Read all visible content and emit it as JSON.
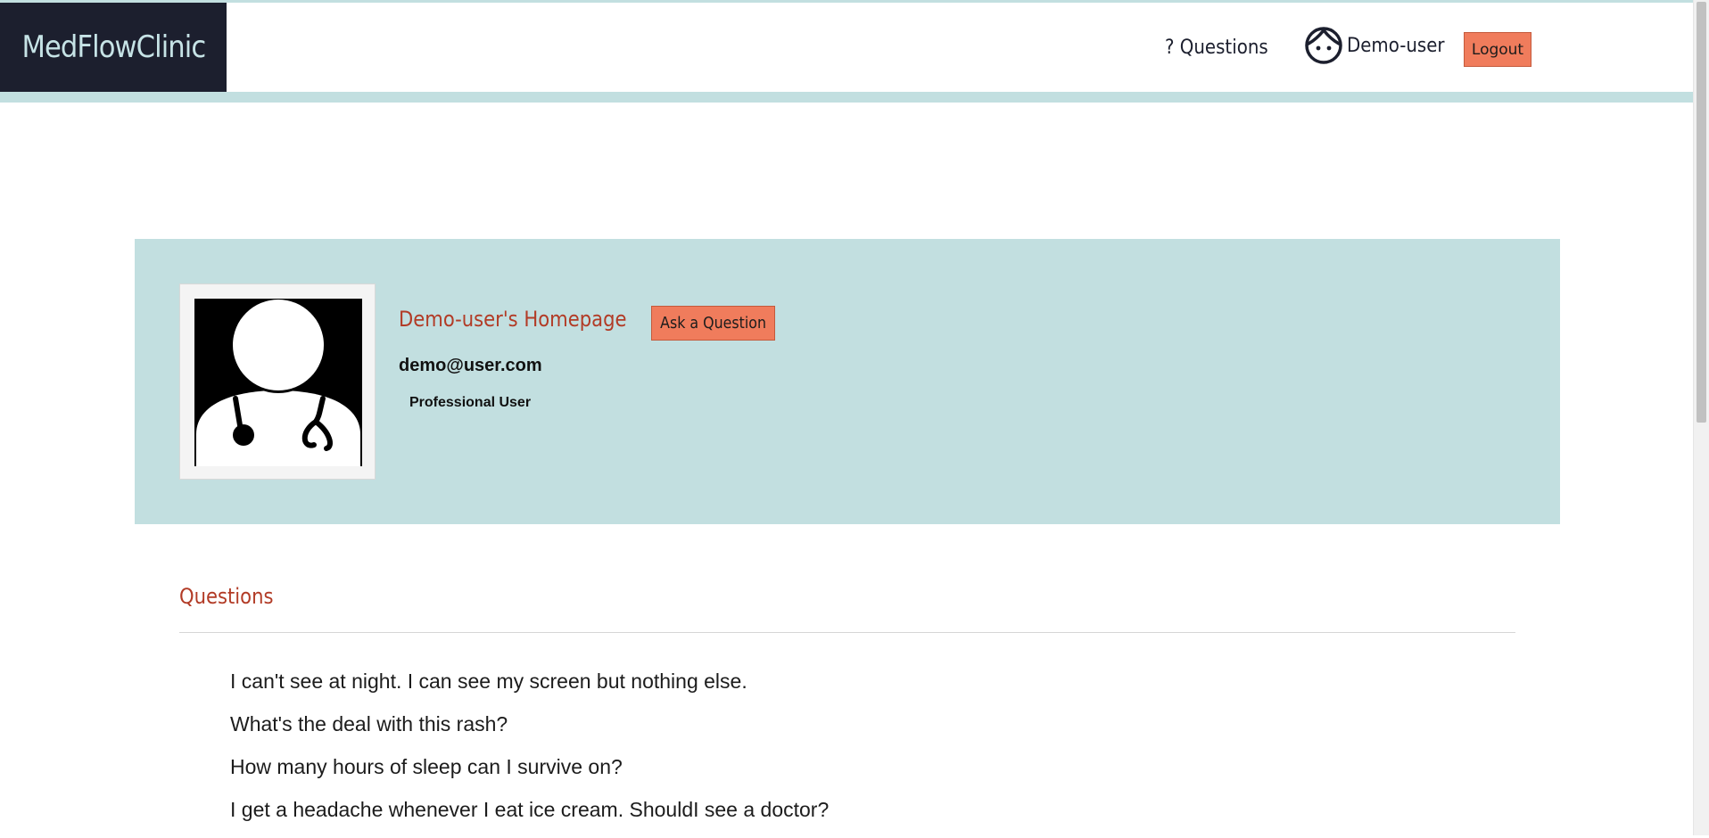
{
  "nav": {
    "brand": "MedFlowClinic",
    "questions_link": "? Questions",
    "user_name": "Demo-user",
    "logout_label": "Logout"
  },
  "profile": {
    "title": "Demo-user's Homepage",
    "ask_button": "Ask a Question",
    "email": "demo@user.com",
    "role": "Professional User"
  },
  "questions": {
    "heading": "Questions",
    "items": [
      "I can't see at night. I can see my screen but nothing else.",
      "What's the deal with this rash?",
      "How many hours of sleep can I survive on?",
      "I get a headache whenever I eat ice cream. ShouldI see a doctor?"
    ]
  },
  "icons": {
    "user": "user-face-icon",
    "avatar": "doctor-stethoscope-avatar"
  },
  "colors": {
    "brand_bg": "#1c1f2e",
    "brand_text": "#c6e3e6",
    "accent": "#f07c5c",
    "card_bg": "#c2dfe0",
    "heading": "#b23b26"
  }
}
